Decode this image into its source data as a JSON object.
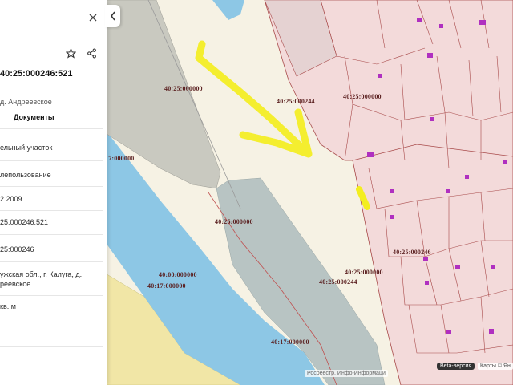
{
  "panel": {
    "cadastral_number_partial": "40:25:000246:521",
    "address_short": "д. Андреевское",
    "documents_tab": "Документы",
    "category": "ельный участок",
    "usage": "лепользование",
    "date": "2.2009",
    "cad_number": "25:000246:521",
    "quarter": "25:000246",
    "address_full_line1": "ужская обл., г. Калуга, д.",
    "address_full_line2": "реевское",
    "area_unit": "кв. м"
  },
  "map": {
    "labels": [
      "40:25:000000",
      "40:25:000244",
      "40:25:000000",
      "17:000000",
      "40:25:000000",
      "40:25:000246",
      "40:25:000000",
      "40:00:000000",
      "40:17:000000",
      "40:25:000244",
      "40:17:000000"
    ]
  },
  "footer": {
    "beta_label": "Beta-версия",
    "maps_label": "Карты © Ян",
    "attribution": "Росреестр, Инфо-Информаци"
  },
  "colors": {
    "river": "#8ec9e6",
    "gray_zone": "#c8c8c0",
    "grayblue_zone": "#b9c5c5",
    "tan_zone": "#f2e6a8",
    "parcel_outline": "#b04a4a",
    "highlight": "#f2ef22",
    "building": "#b030c0"
  },
  "icons": [
    "star-icon",
    "share-icon",
    "close-icon",
    "chevron-left-icon"
  ]
}
